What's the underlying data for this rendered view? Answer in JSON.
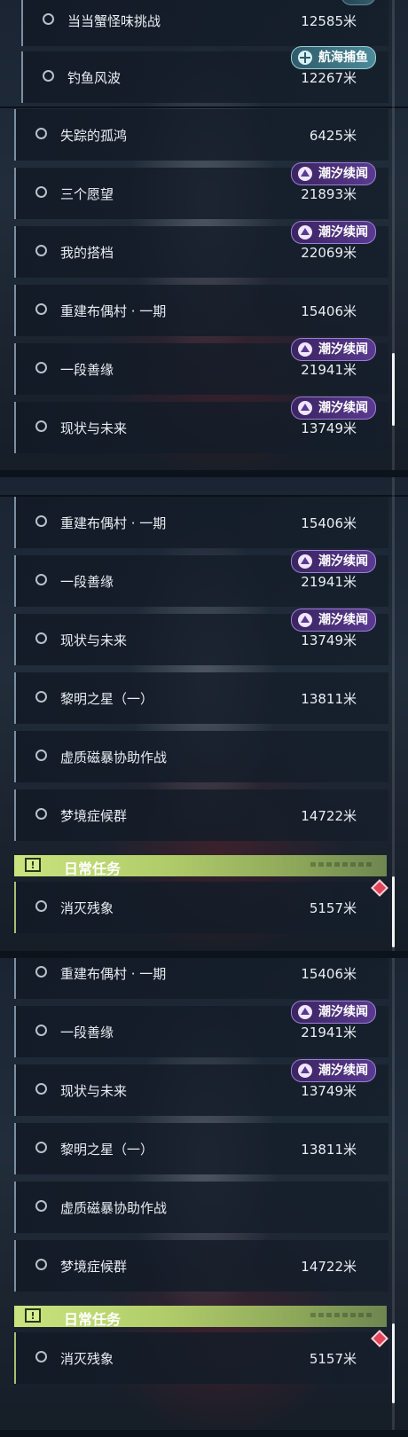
{
  "tags": {
    "tide": "潮汐续闻",
    "fishing": "航海捕鱼"
  },
  "daily_header": {
    "title": "日常任务",
    "icon": "exclamation-icon"
  },
  "panel1": {
    "rows": [
      {
        "name": "当当蟹怪味挑战",
        "dist": "12585米"
      },
      {
        "name": "钓鱼风波",
        "dist": "12267米",
        "tag": "航海捕鱼"
      },
      {
        "name": "失踪的孤鸿",
        "dist": "6425米"
      },
      {
        "name": "三个愿望",
        "dist": "21893米",
        "tag": "潮汐续闻"
      },
      {
        "name": "我的搭档",
        "dist": "22069米",
        "tag": "潮汐续闻"
      },
      {
        "name": "重建布偶村 · 一期",
        "dist": "15406米"
      },
      {
        "name": "一段善缘",
        "dist": "21941米",
        "tag": "潮汐续闻"
      },
      {
        "name": "现状与未来",
        "dist": "13749米",
        "tag": "潮汐续闻"
      }
    ]
  },
  "panel2": {
    "rows": [
      {
        "name": "重建布偶村 · 一期",
        "dist": "15406米"
      },
      {
        "name": "一段善缘",
        "dist": "21941米",
        "tag": "潮汐续闻"
      },
      {
        "name": "现状与未来",
        "dist": "13749米",
        "tag": "潮汐续闻"
      },
      {
        "name": "黎明之星（一）",
        "dist": "13811米"
      },
      {
        "name": "虚质磁暴协助作战",
        "dist": ""
      },
      {
        "name": "梦境症候群",
        "dist": "14722米"
      }
    ],
    "daily_rows": [
      {
        "name": "消灭残象",
        "dist": "5157米"
      }
    ]
  },
  "panel3": {
    "rows": [
      {
        "name": "重建布偶村 · 一期",
        "dist": "15406米"
      },
      {
        "name": "一段善缘",
        "dist": "21941米",
        "tag": "潮汐续闻"
      },
      {
        "name": "现状与未来",
        "dist": "13749米",
        "tag": "潮汐续闻"
      },
      {
        "name": "黎明之星（一）",
        "dist": "13811米"
      },
      {
        "name": "虚质磁暴协助作战",
        "dist": ""
      },
      {
        "name": "梦境症候群",
        "dist": "14722米"
      }
    ],
    "daily_rows": [
      {
        "name": "消灭残象",
        "dist": "5157米"
      }
    ]
  },
  "colors": {
    "tide_tag": "#5a3a91",
    "fishing_tag": "#4b8b9a",
    "daily_accent": "#b1cd6a",
    "marker": "#e0455a"
  }
}
